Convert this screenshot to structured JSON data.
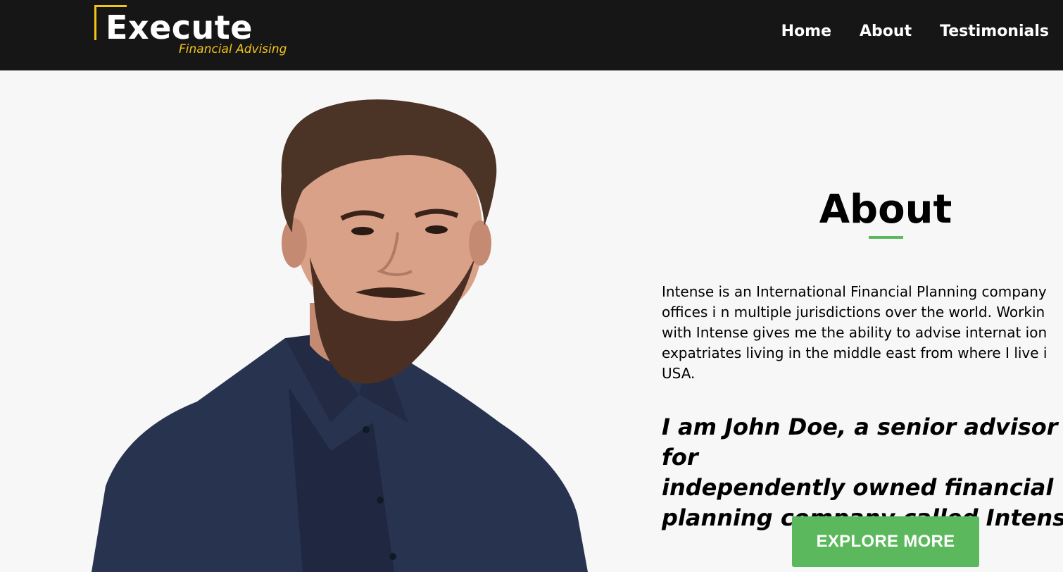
{
  "header": {
    "logo_title": "Execute",
    "logo_tagline": "Financial Advising",
    "nav": [
      "Home",
      "About",
      "Testimonials"
    ]
  },
  "about": {
    "title": "About",
    "paragraph": "Intense is an International Financial Planning company\noffices i n multiple jurisdictions over the world. Workin\nwith Intense gives me the ability to advise internat ion\nexpatriates living in the middle east from where I live i\nUSA.",
    "quote": "I am John Doe, a senior advisor for\nindependently owned financial\nplanning company called Intense.",
    "button_label": "EXPLORE MORE"
  },
  "colors": {
    "navbar_bg": "#161616",
    "accent_yellow": "#f0c419",
    "accent_green": "#5cb85c",
    "page_bg": "#f7f7f7"
  }
}
